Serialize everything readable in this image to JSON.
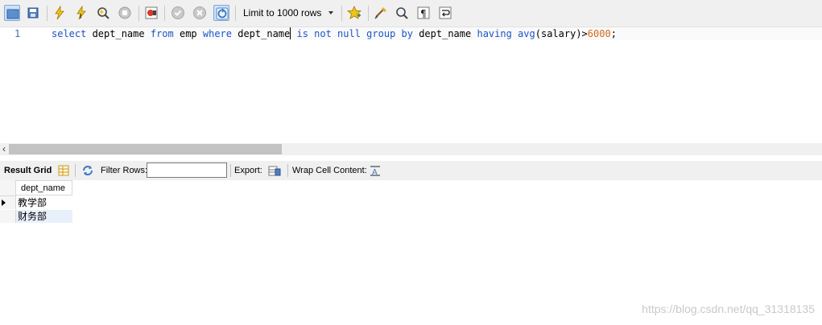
{
  "toolbar": {
    "limit_select_value": "Limit to 1000 rows",
    "icons": [
      "open-folder-icon",
      "save-icon",
      "execute-icon",
      "execute-current-icon",
      "explain-icon",
      "stop-icon",
      "toggle-error-icon",
      "commit-icon",
      "rollback-icon",
      "autocommit-icon",
      "bookmark-icon",
      "beautify-icon",
      "find-icon",
      "invisible-chars-icon",
      "wrap-icon"
    ]
  },
  "editor": {
    "line_number": "1",
    "sql": {
      "t1": "select",
      "t2": " dept_name ",
      "t3": "from",
      "t4": " emp ",
      "t5": "where",
      "t6": " dept_name",
      "t7": " ",
      "t8": "is not null group by",
      "t9": " dept_name ",
      "t10": "having",
      "t11": " ",
      "t12": "avg",
      "t13": "(salary)>",
      "t14": "6000",
      "t15": ";"
    }
  },
  "result_toolbar": {
    "result_grid_label": "Result Grid",
    "filter_rows_label": "Filter Rows:",
    "filter_rows_value": "",
    "export_label": "Export:",
    "wrap_cell_label": "Wrap Cell Content:"
  },
  "grid": {
    "column_header": "dept_name",
    "rows": [
      "教学部",
      "财务部"
    ]
  },
  "watermark": "https://blog.csdn.net/qq_31318135"
}
